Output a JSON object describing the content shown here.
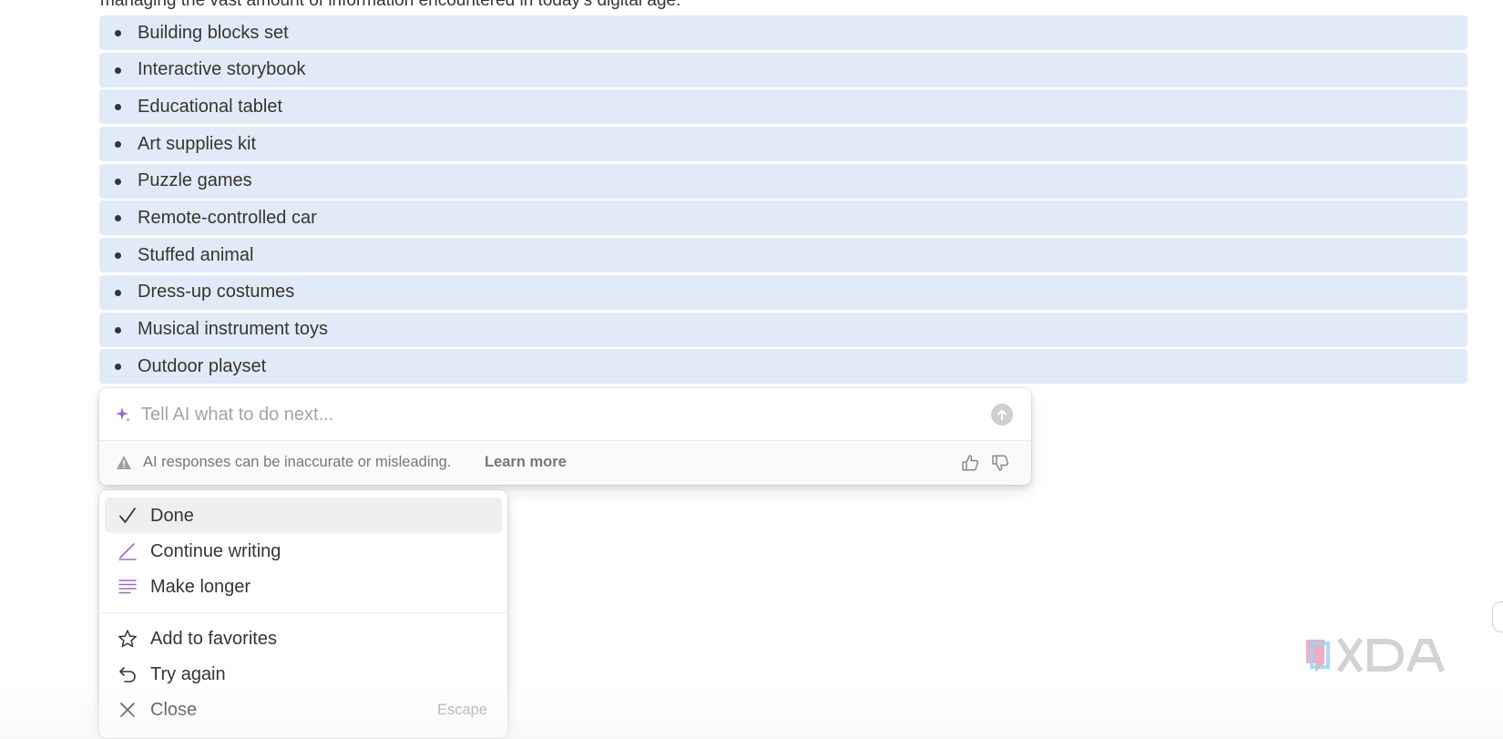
{
  "top_text": "managing the vast amount of information encountered in today's digital age.",
  "bullet_items": [
    "Building blocks set",
    "Interactive storybook",
    "Educational tablet",
    "Art supplies kit",
    "Puzzle games",
    "Remote-controlled car",
    "Stuffed animal",
    "Dress-up costumes",
    "Musical instrument toys",
    "Outdoor playset"
  ],
  "ai_box": {
    "placeholder": "Tell AI what to do next...",
    "disclaimer": "AI responses can be inaccurate or misleading.",
    "learn_more": "Learn more"
  },
  "menu": {
    "primary": [
      {
        "label": "Done",
        "icon": "check-icon"
      },
      {
        "label": "Continue writing",
        "icon": "pen-icon"
      },
      {
        "label": "Make longer",
        "icon": "lines-icon"
      }
    ],
    "secondary": [
      {
        "label": "Add to favorites",
        "icon": "star-icon"
      },
      {
        "label": "Try again",
        "icon": "undo-icon"
      },
      {
        "label": "Close",
        "icon": "close-icon",
        "shortcut": "Escape"
      }
    ]
  },
  "colors": {
    "highlight": "#e1ebf8",
    "accent_purple": "#9b6bc9",
    "text": "#37352f",
    "muted": "#787774"
  },
  "watermark": "XDA"
}
